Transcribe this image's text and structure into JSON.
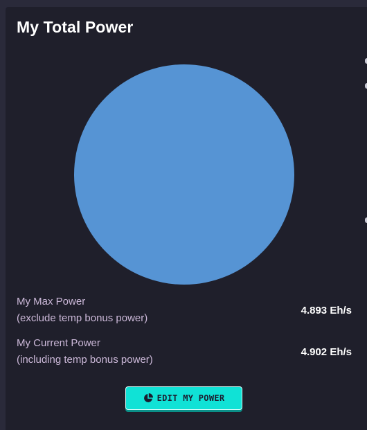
{
  "card": {
    "title": "My Total Power"
  },
  "chart_data": {
    "type": "pie",
    "categories": [
      ""
    ],
    "values": [
      100
    ],
    "colors": [
      "#5694d4"
    ]
  },
  "stats": [
    {
      "label_line1": "My Max Power",
      "label_line2": "(exclude temp bonus power)",
      "value": "4.893 Eh/s"
    },
    {
      "label_line1": "My Current Power",
      "label_line2": "(including temp bonus power)",
      "value": "4.902 Eh/s"
    }
  ],
  "edit_button": {
    "label": "EDIT MY POWER",
    "icon": "pie-chart-icon"
  },
  "colors": {
    "background": "#2a2a3a",
    "card": "#1f1f2b",
    "accent": "#10e2d6",
    "label": "#cbb8d8"
  }
}
